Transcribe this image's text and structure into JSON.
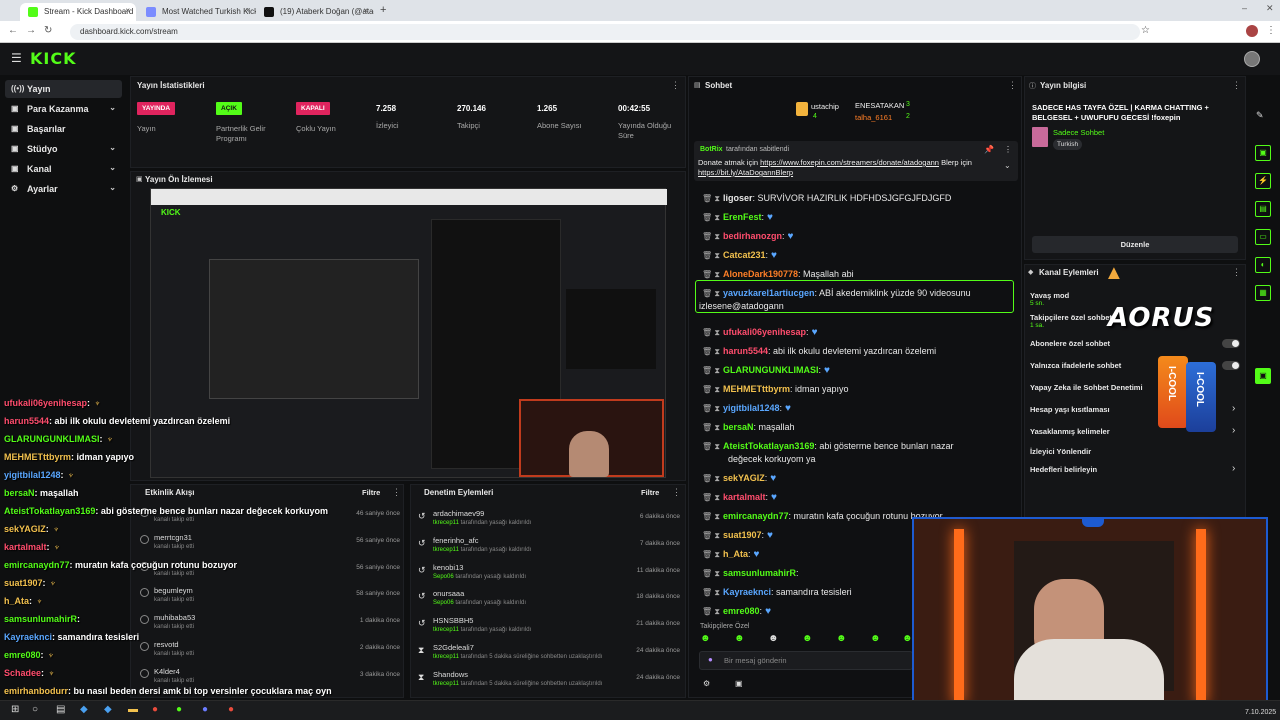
{
  "browser": {
    "tabs": [
      {
        "label": "Stream - Kick Dashboard",
        "color": "#53fc18"
      },
      {
        "label": "Most Watched Turkish Kick Stre",
        "color": "#7b8cff"
      },
      {
        "label": "(19) Ataberk Doğan (@atadog",
        "color": "#111111"
      }
    ],
    "url": "dashboard.kick.com/stream"
  },
  "brand": {
    "logo": "KICK",
    "accent": "#53fc18"
  },
  "sidebar": {
    "items": [
      {
        "label": "Yayın",
        "icon": "broadcast-icon",
        "active": true
      },
      {
        "label": "Para Kazanma",
        "icon": "money-icon"
      },
      {
        "label": "Başarılar",
        "icon": "trophy-icon"
      },
      {
        "label": "Stüdyo",
        "icon": "studio-icon"
      },
      {
        "label": "Kanal",
        "icon": "channel-icon"
      },
      {
        "label": "Ayarlar",
        "icon": "settings-icon"
      }
    ]
  },
  "stats": {
    "title": "Yayın İstatistikleri",
    "items": [
      {
        "badge": "YAYINDA",
        "label": "Yayın",
        "color": "#e0245e"
      },
      {
        "badge": "AÇIK",
        "label": "Partnerlik Gelir Programı",
        "color": "#53fc18"
      },
      {
        "badge": "KAPALI",
        "label": "Çoklu Yayın",
        "color": "#e0245e"
      },
      {
        "value": "7.258",
        "label": "İzleyici"
      },
      {
        "value": "270.146",
        "label": "Takipçi"
      },
      {
        "value": "1.265",
        "label": "Abone Sayısı"
      },
      {
        "value": "00:42:55",
        "label": "Yayında Olduğu Süre"
      }
    ]
  },
  "preview": {
    "title": "Yayın Ön İzlemesi"
  },
  "activity": {
    "title": "Etkinlik Akışı",
    "filter": "Filtre",
    "rows": [
      {
        "name": "",
        "sub": "kanalı takip etti",
        "time": "46 saniye önce"
      },
      {
        "name": "merrtcgn31",
        "sub": "kanalı takip etti",
        "time": "56 saniye önce"
      },
      {
        "name": "",
        "sub": "kanalı takip etti",
        "time": "56 saniye önce"
      },
      {
        "name": "begumleym",
        "sub": "kanalı takip etti",
        "time": "58 saniye önce"
      },
      {
        "name": "muhibaba53",
        "sub": "kanalı takip etti",
        "time": "1 dakika önce"
      },
      {
        "name": "resvotd",
        "sub": "kanalı takip etti",
        "time": "2 dakika önce"
      },
      {
        "name": "K4lder4",
        "sub": "kanalı takip etti",
        "time": "3 dakika önce"
      }
    ]
  },
  "moderation": {
    "title": "Denetim Eylemleri",
    "filter": "Filtre",
    "rows": [
      {
        "name": "ardachimaev99",
        "mod": "tkrecep11",
        "sub": " tarafından yasağı kaldırıldı",
        "time": "6 dakika önce"
      },
      {
        "name": "fenerinho_afc",
        "mod": "tkrecep11",
        "sub": " tarafından yasağı kaldırıldı",
        "time": "7 dakika önce"
      },
      {
        "name": "kenobi13",
        "mod": "Sepo06",
        "sub": " tarafından yasağı kaldırıldı",
        "time": "11 dakika önce"
      },
      {
        "name": "onursaaa",
        "mod": "Sepo06",
        "sub": " tarafından yasağı kaldırıldı",
        "time": "18 dakika önce"
      },
      {
        "name": "HSNSBBH5",
        "mod": "tkrecep11",
        "sub": " tarafından yasağı kaldırıldı",
        "time": "21 dakika önce"
      },
      {
        "name": "S2Gdeleali7",
        "mod": "tkrecep11",
        "sub": " tarafından 5 dakika süreliğine sohbetten uzaklaştırıldı",
        "time": "24 dakika önce"
      },
      {
        "name": "Shandows",
        "mod": "tkrecep11",
        "sub": " tarafından 5 dakika süreliğine sohbetten uzaklaştırıldı",
        "time": "24 dakika önce"
      }
    ]
  },
  "chat": {
    "title": "Sohbet",
    "gifters": [
      {
        "name": "ustachip",
        "count": "4"
      },
      {
        "name": "ENESATAKAN",
        "count": "3"
      },
      {
        "name": "talha_6161",
        "count": "2"
      }
    ],
    "pinned": {
      "bot": "BotRix",
      "by": "tarafından sabitlendi",
      "text": "Donate atmak için ",
      "link": "https://www.foxepin.com/streamers/donate/atadogann",
      "text2": " Blerp için ",
      "link2": "https://bit.ly/AtaDogannBlerp"
    },
    "messages": [
      {
        "user": "ligoser",
        "color": "#e8e8e8",
        "text": ": SURVİVOR HAZIRLIK HDFHDSJGFGJFDJGFD",
        "heart": false
      },
      {
        "user": "ErenFest",
        "color": "#53fc18",
        "text": ":",
        "heart": true
      },
      {
        "user": "bedirhanozgn",
        "color": "#ff4d6d",
        "text": ":",
        "heart": true
      },
      {
        "user": "Catcat231",
        "color": "#f2c14e",
        "text": ":",
        "heart": true
      },
      {
        "user": "AloneDark190778",
        "color": "#ff7f27",
        "text": ": Maşallah abi",
        "heart": false
      },
      {
        "user": "yavuzkarel1artiucgen",
        "color": "#5aa7ff",
        "text": ": ABİ akedemiklink yüzde 90 videosunu",
        "heart": false,
        "highlight": true,
        "text2": "izlesene@atadogann"
      },
      {
        "user": "ufukali06yenihesap",
        "color": "#ff4d6d",
        "text": ":",
        "heart": true
      },
      {
        "user": "harun5544",
        "color": "#ff4d6d",
        "text": ": abi ilk okulu devletemi yazdırcan özelemi",
        "heart": false
      },
      {
        "user": "GLARUNGUNKLIMASI",
        "color": "#53fc18",
        "text": ":",
        "heart": true
      },
      {
        "user": "MEHMETttbyrm",
        "color": "#f2c14e",
        "text": ": idman yapıyo",
        "heart": false
      },
      {
        "user": "yigitbilal1248",
        "color": "#5aa7ff",
        "text": ":",
        "heart": true
      },
      {
        "user": "bersaN",
        "color": "#53fc18",
        "text": ": maşallah",
        "heart": false
      },
      {
        "user": "AteistTokatlayan3169",
        "color": "#53fc18",
        "text": ": abi gösterme bence bunları nazar",
        "heart": false,
        "text2": "değecek korkuyom ya"
      },
      {
        "user": "sekYAGIZ",
        "color": "#f2c14e",
        "text": ":",
        "heart": true
      },
      {
        "user": "kartalmalt",
        "color": "#ff4d6d",
        "text": ":",
        "heart": true
      },
      {
        "user": "emircanaydn77",
        "color": "#53fc18",
        "text": ": muratın kafa çocuğun rotunu bozuyor",
        "heart": false
      },
      {
        "user": "suat1907",
        "color": "#f2c14e",
        "text": ":",
        "heart": true
      },
      {
        "user": "h_Ata",
        "color": "#f2c14e",
        "text": ":",
        "heart": true
      },
      {
        "user": "samsunlumahirR",
        "color": "#53fc18",
        "text": ":",
        "heart": false
      },
      {
        "user": "Kayraeknci",
        "color": "#5aa7ff",
        "text": ": samandıra tesisleri",
        "heart": false
      },
      {
        "user": "emre080",
        "color": "#53fc18",
        "text": ":",
        "heart": true
      }
    ],
    "followers_only": "Takipçilere Özel",
    "placeholder": "Bir mesaj gönderin"
  },
  "overlay_chat": [
    {
      "user": "ufukali06yenihesap",
      "color": "#ff4d6d",
      "text": ":",
      "wings": true
    },
    {
      "user": "harun5544",
      "color": "#ff4d6d",
      "text": ": abi ilk okulu devletemi yazdırcan özelemi",
      "wings": false
    },
    {
      "user": "GLARUNGUNKLIMASI",
      "color": "#53fc18",
      "text": ":",
      "wings": true
    },
    {
      "user": "MEHMETttbyrm",
      "color": "#f2c14e",
      "text": ": idman yapıyo",
      "wings": false
    },
    {
      "user": "yigitbilal1248",
      "color": "#5aa7ff",
      "text": ":",
      "wings": true
    },
    {
      "user": "bersaN",
      "color": "#53fc18",
      "text": ": maşallah",
      "wings": false
    },
    {
      "user": "AteistTokatlayan3169",
      "color": "#53fc18",
      "text": ": abi gösterme bence bunları nazar değecek korkuyom",
      "wings": false
    },
    {
      "user": "sekYAGIZ",
      "color": "#f2c14e",
      "text": ":",
      "wings": true
    },
    {
      "user": "kartalmalt",
      "color": "#ff4d6d",
      "text": ":",
      "wings": true
    },
    {
      "user": "emircanaydn77",
      "color": "#53fc18",
      "text": ": muratın kafa çocuğun rotunu bozuyor",
      "wings": false
    },
    {
      "user": "suat1907",
      "color": "#f2c14e",
      "text": ":",
      "wings": true
    },
    {
      "user": "h_Ata",
      "color": "#f2c14e",
      "text": ":",
      "wings": true
    },
    {
      "user": "samsunlumahirR",
      "color": "#53fc18",
      "text": ":",
      "wings": false
    },
    {
      "user": "Kayraeknci",
      "color": "#5aa7ff",
      "text": ": samandıra tesisleri",
      "wings": false
    },
    {
      "user": "emre080",
      "color": "#53fc18",
      "text": ":",
      "wings": true
    },
    {
      "user": "Schadee",
      "color": "#ff4d6d",
      "text": ":",
      "wings": true
    },
    {
      "user": "emirhanbodurr",
      "color": "#f2c14e",
      "text": ": bu nasıl beden dersi amk bi top versinler çocuklara maç oyn",
      "wings": false
    }
  ],
  "stream_info": {
    "title": "Yayın bilgisi",
    "stream_title": "SADECE HAS TAYFA ÖZEL | KARMA CHATTING + BELGESEL + UWUFUFU GECESİ !foxepin",
    "category": "Sadece Sohbet",
    "tag": "Turkish",
    "edit": "Düzenle"
  },
  "channel_actions": {
    "title": "Kanal Eylemleri",
    "items": [
      {
        "label": "Yavaş mod",
        "sub": "5 sn."
      },
      {
        "label": "Takipçilere özel sohbet",
        "sub": "1 sa."
      },
      {
        "label": "Abonelere özel sohbet"
      },
      {
        "label": "Yalnızca ifadelerle sohbet"
      },
      {
        "label": "Yapay Zeka ile Sohbet Denetimi"
      },
      {
        "label": "Hesap yaşı kısıtlaması"
      },
      {
        "label": "Yasaklanmış kelimeler"
      },
      {
        "label": "İzleyici Yönlendir"
      },
      {
        "label": "Hedefleri belirleyin"
      }
    ]
  },
  "sponsor": {
    "brand": "AORUS",
    "product": "I-COOL"
  },
  "taskbar": {
    "date": "7.10.2025"
  }
}
